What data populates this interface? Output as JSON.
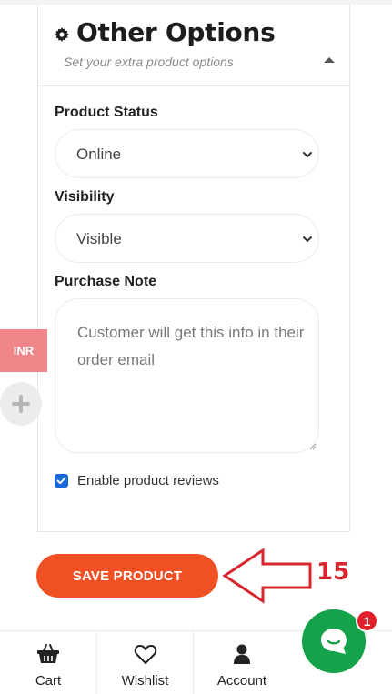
{
  "section": {
    "title": "Other Options",
    "subtitle": "Set your extra product options",
    "icon": "gear-icon"
  },
  "product_status": {
    "label": "Product Status",
    "value": "Online"
  },
  "visibility": {
    "label": "Visibility",
    "value": "Visible"
  },
  "purchase_note": {
    "label": "Purchase Note",
    "placeholder": "Customer will get this info in their order email"
  },
  "reviews": {
    "label": "Enable product reviews",
    "checked": true
  },
  "save_button": {
    "label": "SAVE PRODUCT"
  },
  "annotation": {
    "step": "15",
    "color": "#d9262e"
  },
  "currency_tab": {
    "label": "INR"
  },
  "bottom_nav": {
    "items": [
      {
        "label": "Cart",
        "icon": "basket-icon"
      },
      {
        "label": "Wishlist",
        "icon": "heart-icon"
      },
      {
        "label": "Account",
        "icon": "user-icon"
      }
    ]
  },
  "chat": {
    "badge": "1",
    "icon": "chat-icon"
  },
  "colors": {
    "accent": "#ef5124",
    "chat": "#14a34a",
    "currency": "#f0868a",
    "checkbox": "#1668d8"
  }
}
